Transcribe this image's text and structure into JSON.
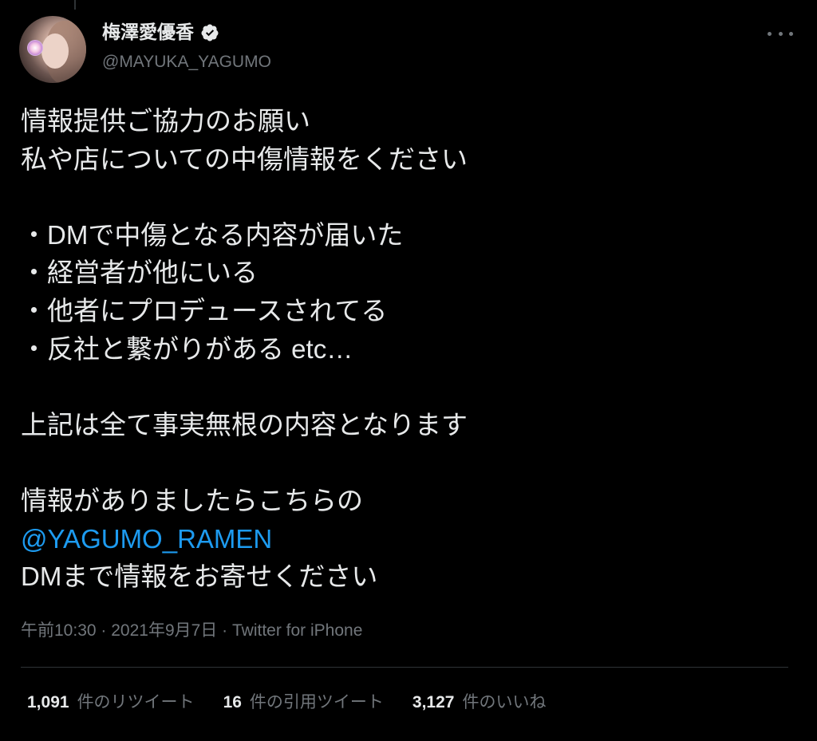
{
  "author": {
    "display_name": "梅澤愛優香",
    "handle": "@MAYUKA_YAGUMO",
    "verified": true,
    "avatar_icon": "profile-photo"
  },
  "more_icon": "more-horizontal-icon",
  "tweet": {
    "lines": [
      "情報提供ご協力のお願い",
      "私や店についての中傷情報をください",
      "",
      "・DMで中傷となる内容が届いた",
      "・経営者が他にいる",
      "・他者にプロデュースされてる",
      "・反社と繋がりがある etc…",
      "",
      "上記は全て事実無根の内容となります",
      "",
      "情報がありましたらこちらの"
    ],
    "mention": "@YAGUMO_RAMEN",
    "last_line": "DMまで情報をお寄せください"
  },
  "meta": {
    "time": "午前10:30",
    "date": "2021年9月7日",
    "source": "Twitter for iPhone",
    "separator": " · "
  },
  "stats": {
    "retweets_count": "1,091",
    "retweets_label": "件のリツイート",
    "quotes_count": "16",
    "quotes_label": "件の引用ツイート",
    "likes_count": "3,127",
    "likes_label": "件のいいね"
  },
  "colors": {
    "background": "#000000",
    "text": "#e7e9ea",
    "secondary": "#71767b",
    "link": "#1d9bf0",
    "divider": "#2f3336"
  }
}
